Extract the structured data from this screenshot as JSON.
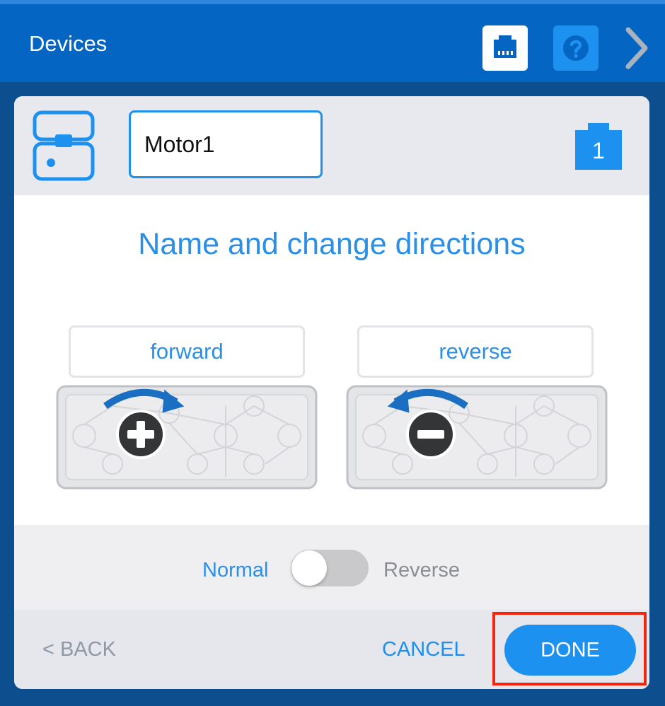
{
  "header": {
    "title": "Devices"
  },
  "device": {
    "name_value": "Motor1",
    "port_number": "1"
  },
  "main": {
    "title": "Name and change directions",
    "forward_label": "forward",
    "reverse_label": "reverse"
  },
  "toggle": {
    "normal_label": "Normal",
    "reverse_label": "Reverse",
    "state": "Normal"
  },
  "footer": {
    "back_label": "< BACK",
    "cancel_label": "CANCEL",
    "done_label": "DONE"
  },
  "colors": {
    "header_bg": "#0565c2",
    "accent": "#1c91ef",
    "highlight": "#f3250e"
  }
}
